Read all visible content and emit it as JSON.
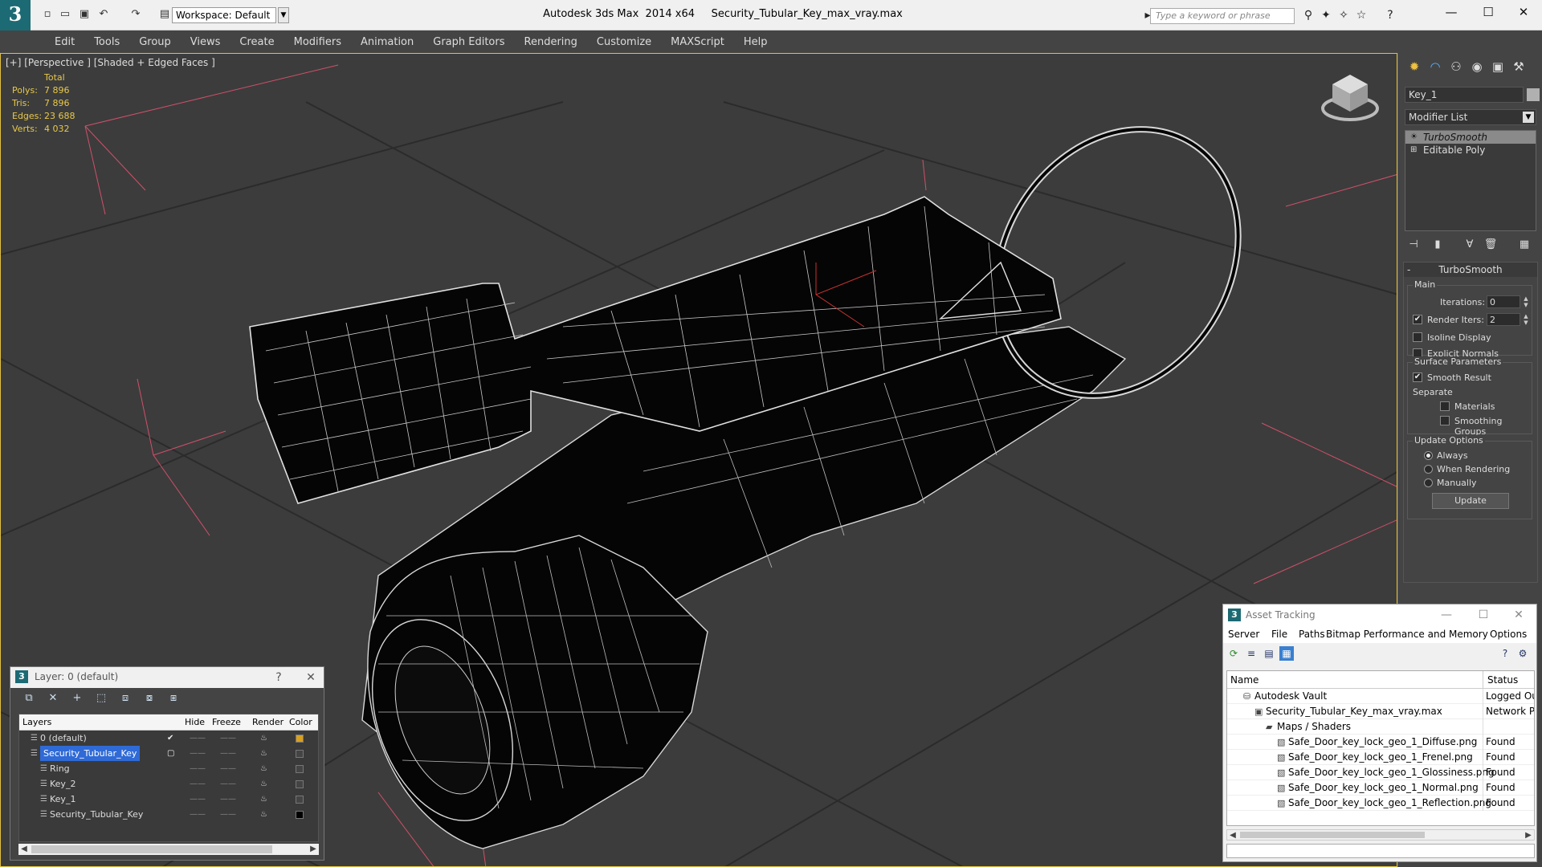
{
  "titlebar": {
    "workspace": "Workspace: Default",
    "app_title": "Autodesk 3ds Max  2014 x64     Security_Tubular_Key_max_vray.max",
    "search_placeholder": "Type a keyword or phrase"
  },
  "menu": [
    "Edit",
    "Tools",
    "Group",
    "Views",
    "Create",
    "Modifiers",
    "Animation",
    "Graph Editors",
    "Rendering",
    "Customize",
    "MAXScript",
    "Help"
  ],
  "viewport": {
    "label": "[+] [Perspective ] [Shaded + Edged Faces ]",
    "stats": {
      "header": "Total",
      "rows": [
        {
          "k": "Polys:",
          "v": "7 896"
        },
        {
          "k": "Tris:",
          "v": "7 896"
        },
        {
          "k": "Edges:",
          "v": "23 688"
        },
        {
          "k": "Verts:",
          "v": "4 032"
        }
      ]
    }
  },
  "command_panel": {
    "object_name": "Key_1",
    "modifier_list": "Modifier List",
    "stack": [
      {
        "label": "TurboSmooth",
        "selected": true
      },
      {
        "label": "Editable Poly",
        "selected": false
      }
    ],
    "rollout_title": "TurboSmooth",
    "main_label": "Main",
    "iterations_label": "Iterations:",
    "iterations_value": "0",
    "render_iters_label": "Render Iters:",
    "render_iters_value": "2",
    "isoline_label": "Isoline Display",
    "explicit_normals_label": "Explicit Normals",
    "surface_params_label": "Surface Parameters",
    "smooth_result_label": "Smooth Result",
    "separate_label": "Separate",
    "materials_label": "Materials",
    "smoothing_groups_label": "Smoothing Groups",
    "update_options_label": "Update Options",
    "always_label": "Always",
    "when_rendering_label": "When Rendering",
    "manually_label": "Manually",
    "update_button": "Update"
  },
  "layer_window": {
    "title": "Layer: 0 (default)",
    "help": "?",
    "columns": {
      "layers": "Layers",
      "hide": "Hide",
      "freeze": "Freeze",
      "render": "Render",
      "color": "Color"
    },
    "rows": [
      {
        "name": "0 (default)",
        "indent": 1,
        "color": "#d8a020"
      },
      {
        "name": "Security_Tubular_Key",
        "indent": 1,
        "color": "#444444",
        "selected": true
      },
      {
        "name": "Ring",
        "indent": 2,
        "color": "#444444"
      },
      {
        "name": "Key_2",
        "indent": 2,
        "color": "#444444"
      },
      {
        "name": "Key_1",
        "indent": 2,
        "color": "#444444"
      },
      {
        "name": "Security_Tubular_Key",
        "indent": 2,
        "color": "#000000"
      }
    ]
  },
  "asset_window": {
    "title": "Asset Tracking",
    "menu": [
      "Server",
      "File",
      "Paths",
      "Bitmap Performance and Memory",
      "Options"
    ],
    "columns": {
      "name": "Name",
      "status": "Status"
    },
    "rows": [
      {
        "name": "Autodesk Vault",
        "indent": 0,
        "status": "Logged Out"
      },
      {
        "name": "Security_Tubular_Key_max_vray.max",
        "indent": 1,
        "status": "Network Path"
      },
      {
        "name": "Maps / Shaders",
        "indent": 2,
        "status": ""
      },
      {
        "name": "Safe_Door_key_lock_geo_1_Diffuse.png",
        "indent": 3,
        "status": "Found"
      },
      {
        "name": "Safe_Door_key_lock_geo_1_Frenel.png",
        "indent": 3,
        "status": "Found"
      },
      {
        "name": "Safe_Door_key_lock_geo_1_Glossiness.png",
        "indent": 3,
        "status": "Found"
      },
      {
        "name": "Safe_Door_key_lock_geo_1_Normal.png",
        "indent": 3,
        "status": "Found"
      },
      {
        "name": "Safe_Door_key_lock_geo_1_Reflection.png",
        "indent": 3,
        "status": "Found"
      }
    ]
  },
  "colors": {
    "stats": "#e8c84a",
    "selection": "#2f6ad6",
    "viewport_border": "#e0c040"
  }
}
